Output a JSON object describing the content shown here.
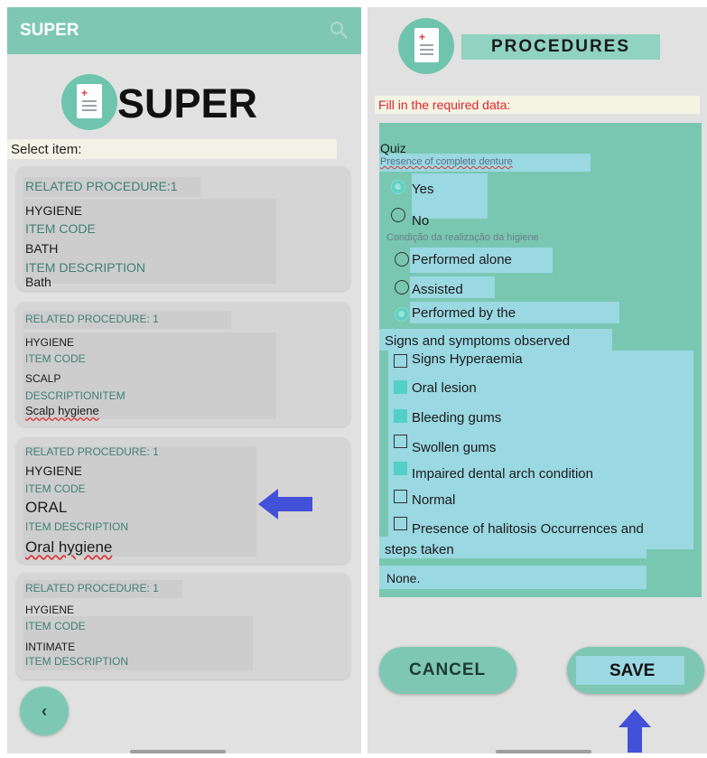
{
  "left": {
    "app_title": "SUPER",
    "brand": "SUPER",
    "select_label": "Select item:",
    "cards": [
      {
        "related": "RELATED PROCEDURE:1",
        "category": "HYGIENE",
        "code_label": "ITEM CODE",
        "code": "BATH",
        "desc_label": "ITEM DESCRIPTION",
        "desc": "Bath"
      },
      {
        "related": "RELATED PROCEDURE: 1",
        "category": "HYGIENE",
        "code_label": "ITEM CODE",
        "code": "SCALP",
        "desc_label": "DESCRIPTIONITEM",
        "desc": "Scalp hygiene"
      },
      {
        "related": "RELATED PROCEDURE: 1",
        "category": "HYGIENE",
        "code_label": "ITEM CODE",
        "code": "ORAL",
        "desc_label": "ITEM DESCRIPTION",
        "desc": "Oral hygiene"
      },
      {
        "related": "RELATED PROCEDURE: 1",
        "category": "HYGIENE",
        "code_label": "ITEM CODE",
        "code": "INTIMATE",
        "desc_label": "ITEM DESCRIPTION"
      }
    ],
    "back_icon": "chevron-left-icon"
  },
  "right": {
    "title": "PROCEDURES",
    "fill_label": "Fill in the required data:",
    "quiz": "Quiz",
    "q1_label": "Presence of complete denture",
    "q1_options": [
      "Yes",
      "No"
    ],
    "q1_selected": "Yes",
    "q2_label": "Condição da realização da higiene",
    "q2_options": [
      "Performed alone",
      "Assisted",
      "Performed by the"
    ],
    "q2_selected": "Performed by the",
    "signs_label": "Signs and symptoms observed",
    "checks": [
      {
        "label": "Signs Hyperaemia",
        "checked": false
      },
      {
        "label": "Oral lesion",
        "checked": true
      },
      {
        "label": "Bleeding gums",
        "checked": true
      },
      {
        "label": "Swollen gums",
        "checked": false
      },
      {
        "label": "Impaired dental arch condition",
        "checked": true
      },
      {
        "label": "Normal",
        "checked": false
      },
      {
        "label": "Presence of halitosis Occurrences and",
        "checked": false
      }
    ],
    "steps_text": "steps taken",
    "occurrence_value": "None.",
    "cancel": "CANCEL",
    "save": "SAVE"
  },
  "colors": {
    "accent": "#7ec8b3",
    "highlight": "#9ad8e2",
    "required": "#e0242a",
    "annotation_arrow": "#4350d8"
  }
}
